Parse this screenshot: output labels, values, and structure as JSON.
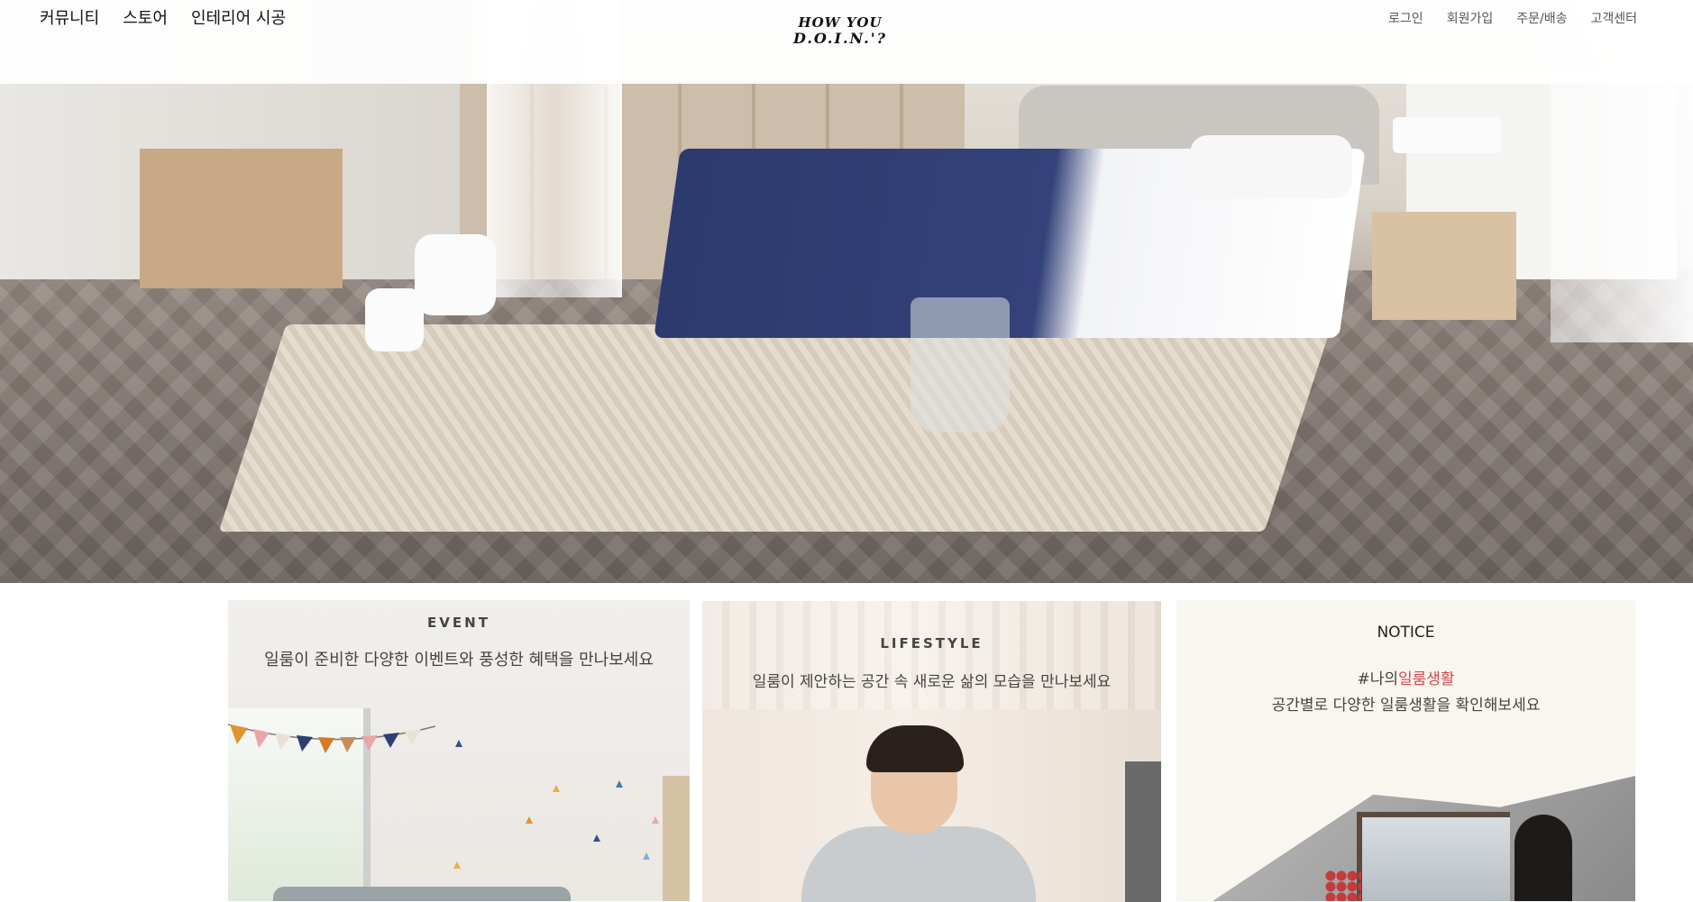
{
  "header": {
    "nav": [
      {
        "label": "커뮤니티"
      },
      {
        "label": "스토어"
      },
      {
        "label": "인테리어 시공"
      }
    ],
    "logo": {
      "line1": "HOW YOU",
      "line2": "D.O.I.N.'?"
    },
    "util": [
      {
        "label": "로그인"
      },
      {
        "label": "회원가입"
      },
      {
        "label": "주문/배송"
      },
      {
        "label": "고객센터"
      }
    ]
  },
  "cards": {
    "event": {
      "title": "EVENT",
      "description": "일룸이 준비한 다양한 이벤트와 풍성한 혜택을 만나보세요"
    },
    "lifestyle": {
      "title": "LIFESTYLE",
      "description": "일룸이 제안하는 공간 속 새로운 삶의 모습을 만나보세요"
    },
    "notice": {
      "title": "NOTICE",
      "tag_prefix": "#나의",
      "tag_highlight": "일룸생활",
      "description": "공간별로 다양한 일룸생활을 확인해보세요"
    }
  },
  "colors": {
    "highlight": "#d2474d",
    "text": "#111111",
    "util_text": "#555555"
  }
}
